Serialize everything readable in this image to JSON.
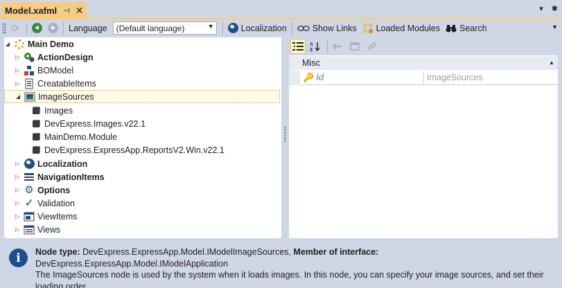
{
  "tab": {
    "title": "Model.xafml",
    "pin_glyph": "⊣",
    "close_glyph": "✕"
  },
  "window_controls": {
    "dropdown_glyph": "▾",
    "settings_glyph": "✱"
  },
  "toolbar": {
    "language_label": "Language",
    "language_value": "(Default language)",
    "localization": "Localization",
    "show_links": "Show Links",
    "loaded_modules": "Loaded Modules",
    "search": "Search"
  },
  "tree": {
    "root": "Main Demo",
    "items": [
      {
        "label": "ActionDesign",
        "bold": true,
        "icon": "action-design-icon"
      },
      {
        "label": "BOModel",
        "bold": false,
        "icon": "bomodel-icon"
      },
      {
        "label": "CreatableItems",
        "bold": false,
        "icon": "creatable-items-icon"
      },
      {
        "label": "ImageSources",
        "bold": false,
        "icon": "image-sources-icon",
        "selected": true,
        "expanded": true
      },
      {
        "label": "Images",
        "bold": false,
        "icon": "module-cube-icon",
        "child": true
      },
      {
        "label": "DevExpress.Images.v22.1",
        "bold": false,
        "icon": "module-cube-icon",
        "child": true
      },
      {
        "label": "MainDemo.Module",
        "bold": false,
        "icon": "module-cube-icon",
        "child": true
      },
      {
        "label": "DevExpress.ExpressApp.ReportsV2.Win.v22.1",
        "bold": false,
        "icon": "module-cube-icon",
        "child": true
      },
      {
        "label": "Localization",
        "bold": true,
        "icon": "globe-icon"
      },
      {
        "label": "NavigationItems",
        "bold": true,
        "icon": "navigation-items-icon"
      },
      {
        "label": "Options",
        "bold": true,
        "icon": "gear-icon"
      },
      {
        "label": "Validation",
        "bold": false,
        "icon": "checkmark-icon"
      },
      {
        "label": "ViewItems",
        "bold": false,
        "icon": "view-items-icon"
      },
      {
        "label": "Views",
        "bold": false,
        "icon": "views-icon"
      }
    ]
  },
  "properties": {
    "category": "Misc",
    "rows": [
      {
        "name": "Id",
        "value": "ImageSources"
      }
    ]
  },
  "info": {
    "node_type_label": "Node type:",
    "node_type_value": "DevExpress.ExpressApp.Model.IModelImageSources,",
    "member_label": "Member of interface:",
    "member_value": "DevExpress.ExpressApp.Model.IModelApplication",
    "description": "The ImageSources node is used by the system when it loads images. In this node, you can specify your image sources, and set their loading order."
  },
  "colors": {
    "accent_tab": "#f5cc84",
    "chrome": "#cfd6e5",
    "selection": "#fffbea",
    "icon_blue": "#1c4f8c",
    "icon_green": "#388a34"
  }
}
